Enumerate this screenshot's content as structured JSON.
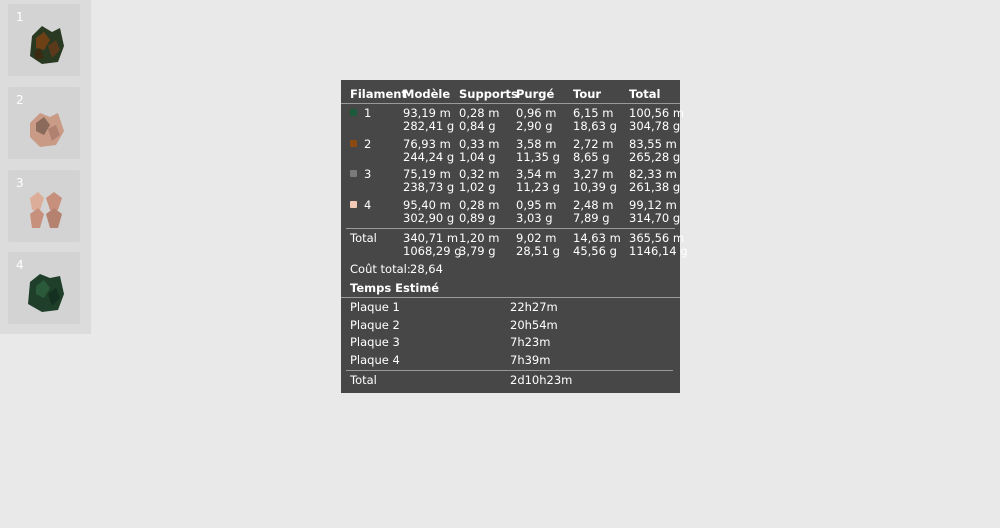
{
  "plates": [
    {
      "number": "1",
      "colors": [
        "#2a3a22",
        "#6e4016",
        "#5a3a1a"
      ]
    },
    {
      "number": "2",
      "colors": [
        "#c99a86",
        "#8a6a5a",
        "#b08070"
      ]
    },
    {
      "number": "3",
      "colors": [
        "#dcae9a",
        "#c7907c",
        "#b68270"
      ]
    },
    {
      "number": "4",
      "colors": [
        "#1f3f2a",
        "#2a5a3a",
        "#143020"
      ]
    }
  ],
  "stats": {
    "headers": {
      "filament": "Filament",
      "model": "Modèle",
      "supports": "Supports",
      "purge": "Purgé",
      "tower": "Tour",
      "total": "Total"
    },
    "rows": [
      {
        "id": "1",
        "color": "#1b5a3a",
        "model": [
          "93,19 m",
          "282,41 g"
        ],
        "supports": [
          "0,28 m",
          "0,84 g"
        ],
        "purge": [
          "0,96 m",
          "2,90 g"
        ],
        "tower": [
          "6,15 m",
          "18,63 g"
        ],
        "total": [
          "100,56 m",
          "304,78 g"
        ]
      },
      {
        "id": "2",
        "color": "#8a4a12",
        "model": [
          "76,93 m",
          "244,24 g"
        ],
        "supports": [
          "0,33 m",
          "1,04 g"
        ],
        "purge": [
          "3,58 m",
          "11,35 g"
        ],
        "tower": [
          "2,72 m",
          "8,65 g"
        ],
        "total": [
          "83,55 m",
          "265,28 g"
        ]
      },
      {
        "id": "3",
        "color": "#7a7a7a",
        "model": [
          "75,19 m",
          "238,73 g"
        ],
        "supports": [
          "0,32 m",
          "1,02 g"
        ],
        "purge": [
          "3,54 m",
          "11,23 g"
        ],
        "tower": [
          "3,27 m",
          "10,39 g"
        ],
        "total": [
          "82,33 m",
          "261,38 g"
        ]
      },
      {
        "id": "4",
        "color": "#f2c9b6",
        "model": [
          "95,40 m",
          "302,90 g"
        ],
        "supports": [
          "0,28 m",
          "0,89 g"
        ],
        "purge": [
          "0,95 m",
          "3,03 g"
        ],
        "tower": [
          "2,48 m",
          "7,89 g"
        ],
        "total": [
          "99,12 m",
          "314,70 g"
        ]
      }
    ],
    "total_row": {
      "label": "Total",
      "model": [
        "340,71 m",
        "1068,29 g"
      ],
      "supports": [
        "1,20 m",
        "3,79 g"
      ],
      "purge": [
        "9,02 m",
        "28,51 g"
      ],
      "tower": [
        "14,63 m",
        "45,56 g"
      ],
      "total": [
        "365,56 m",
        "1146,14 g"
      ]
    },
    "cost_label": "Coût total:",
    "cost_value": "28,64",
    "time_header": "Temps Estimé",
    "plates_time": [
      {
        "label": "Plaque 1",
        "value": "22h27m"
      },
      {
        "label": "Plaque 2",
        "value": "20h54m"
      },
      {
        "label": "Plaque 3",
        "value": "7h23m"
      },
      {
        "label": "Plaque 4",
        "value": "7h39m"
      }
    ],
    "time_total_label": "Total",
    "time_total_value": "2d10h23m"
  }
}
